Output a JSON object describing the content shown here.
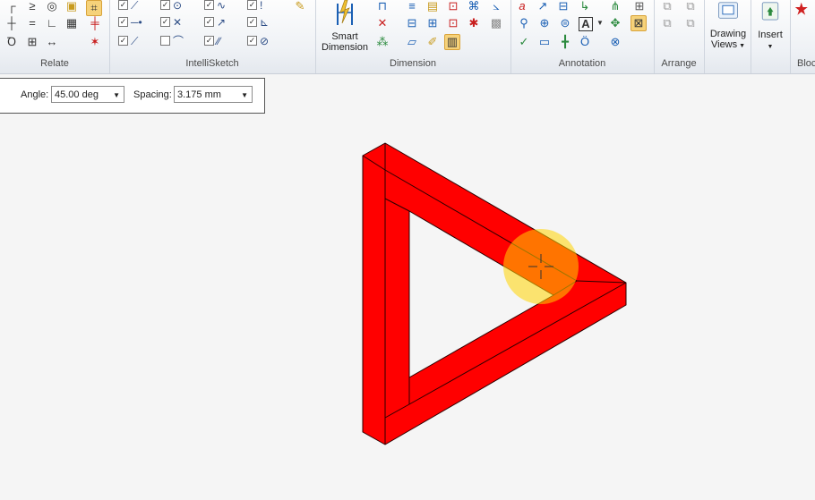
{
  "ribbon": {
    "groups": [
      {
        "label": "Relate"
      },
      {
        "label": "IntelliSketch"
      },
      {
        "label": "Dimension"
      },
      {
        "label": "Annotation"
      },
      {
        "label": "Arrange"
      }
    ],
    "smart_dimension": {
      "line1": "Smart",
      "line2": "Dimension"
    },
    "drawing_views": {
      "line1": "Drawing",
      "line2": "Views"
    },
    "insert": {
      "label": "Insert"
    },
    "blocks": {
      "label": "Bloc"
    }
  },
  "options_bar": {
    "angle_label": "Angle:",
    "angle_value": "45.00 deg",
    "spacing_label": "Spacing:",
    "spacing_value": "3.175 mm"
  },
  "colors": {
    "shape_fill": "#ff0000",
    "cursor_highlight": "#ffd700"
  }
}
